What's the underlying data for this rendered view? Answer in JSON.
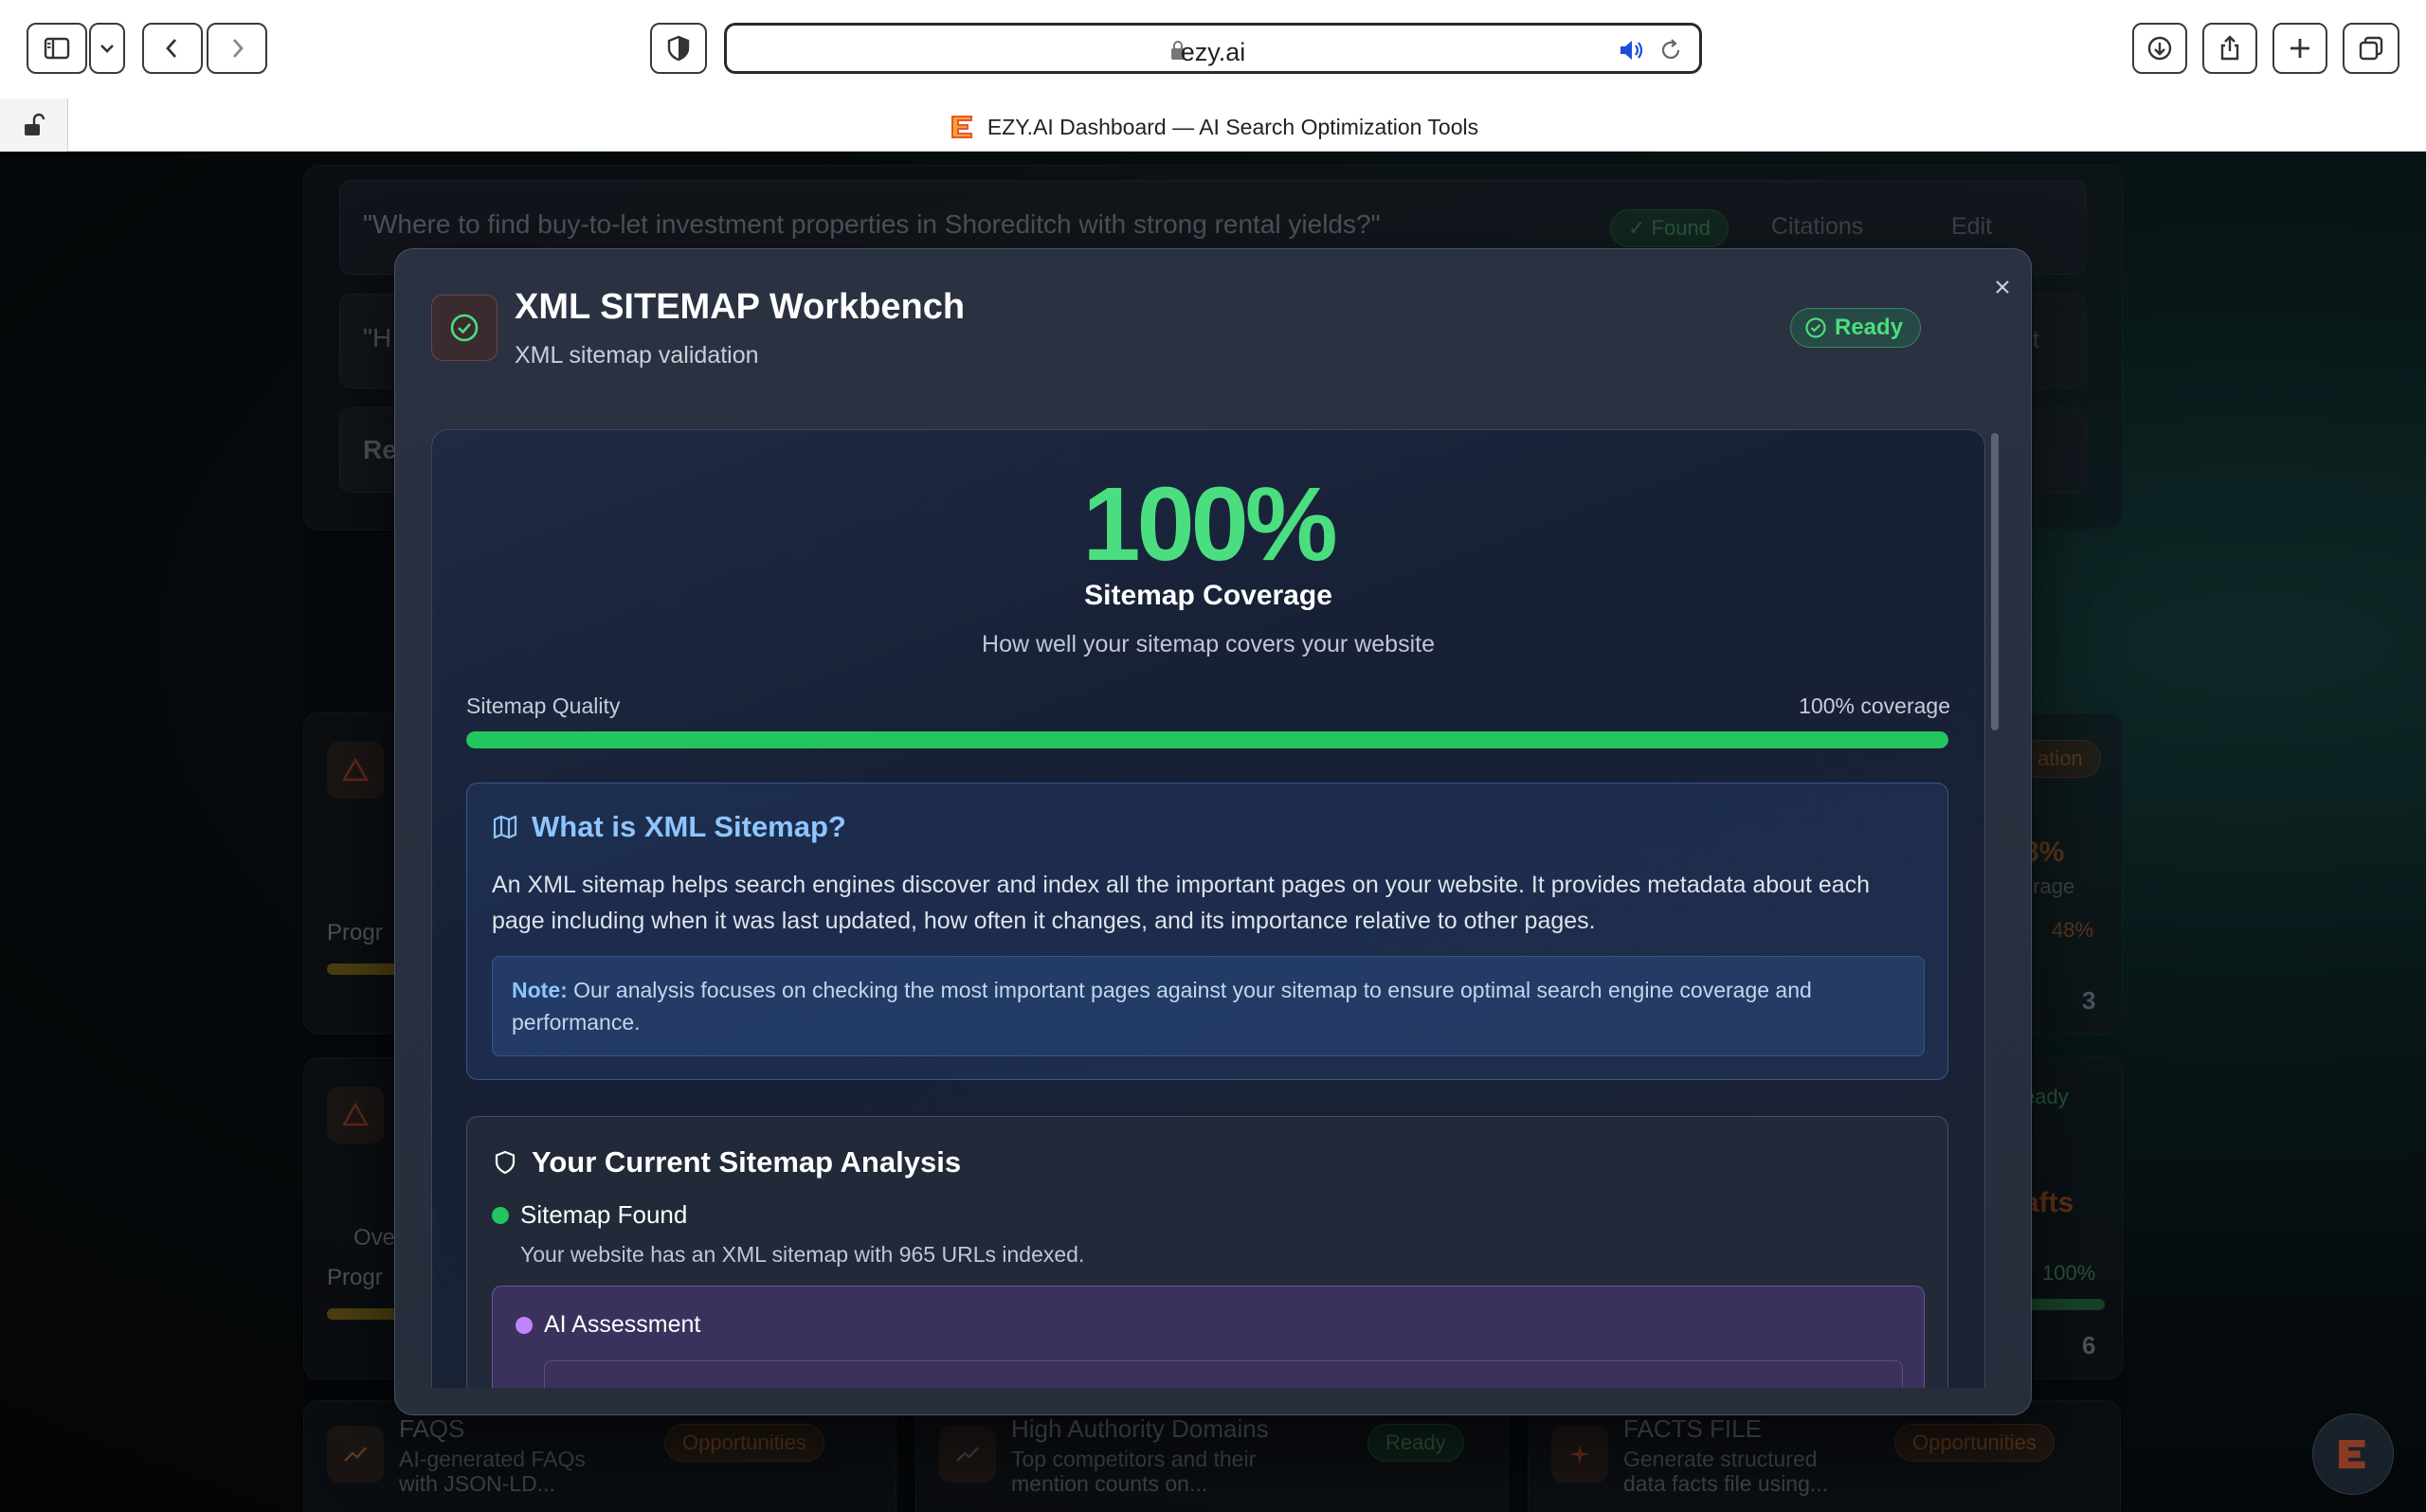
{
  "browser": {
    "url": "ezy.ai",
    "tab_title": "EZY.AI Dashboard — AI Search Optimization Tools"
  },
  "background": {
    "query_1": "\"Where to find buy-to-let investment properties in Shoreditch with strong rental yields?\"",
    "query_1_status": "✓ Found",
    "citations_label": "Citations",
    "edit_label": "Edit",
    "query_2_start": "\"H",
    "query_2_end": "t",
    "re_fragment": "Re",
    "progress_fragment_1": "Progr",
    "progress_fragment_2": "Progr",
    "over_fragment": "Over",
    "right_pill_1": "ation",
    "right_pct": "8%",
    "right_coverage": "erage",
    "right_small_pct": "48%",
    "right_count_1": "3",
    "right_ready": "eady",
    "right_drafts": "afts",
    "right_pct_2": "100%",
    "right_count_2": "6",
    "cards": [
      {
        "title": "FAQS",
        "desc_1": "AI-generated FAQs",
        "desc_2": "with JSON-LD...",
        "badge": "Opportunities"
      },
      {
        "title": "High Authority Domains",
        "desc_1": "Top competitors and their",
        "desc_2": "mention counts on...",
        "badge": "Ready"
      },
      {
        "title": "FACTS FILE",
        "desc_1": "Generate structured",
        "desc_2": "data facts file using...",
        "badge": "Opportunities"
      }
    ]
  },
  "modal": {
    "title": "XML SITEMAP Workbench",
    "subtitle": "XML sitemap validation",
    "status": "Ready",
    "coverage_percent": "100%",
    "coverage_title": "Sitemap Coverage",
    "coverage_subtitle": "How well your sitemap covers your website",
    "quality_label": "Sitemap Quality",
    "quality_value": "100% coverage",
    "quality_fraction": 1.0,
    "info": {
      "title": "What is XML Sitemap?",
      "text": "An XML sitemap helps search engines discover and index all the important pages on your website. It provides metadata about each page including when it was last updated, how often it changes, and its importance relative to other pages.",
      "note_label": "Note:",
      "note_text": " Our analysis focuses on checking the most important pages against your sitemap to ensure optimal search engine coverage and performance."
    },
    "analysis": {
      "title": "Your Current Sitemap Analysis",
      "found_label": "Sitemap Found",
      "found_desc": "Your website has an XML sitemap with 965 URLs indexed.",
      "ai_label": "AI Assessment"
    }
  },
  "colors": {
    "accent_green": "#4ade80",
    "bar_green": "#22c55e",
    "info_blue": "#8ec5ff",
    "ai_purple": "#c084fc"
  }
}
